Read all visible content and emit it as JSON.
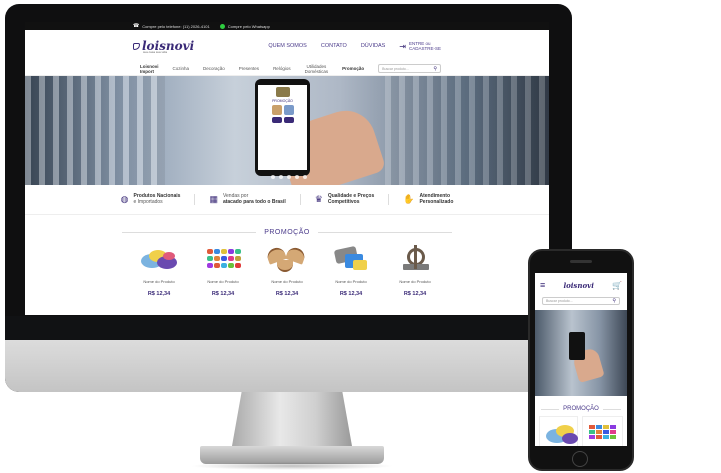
{
  "topbar": {
    "phone_text": "Compre pelo telefone: (11) 2026-4101",
    "whatsapp_text": "Compre pelo Whatsapp"
  },
  "header": {
    "logo_text": "loisnovi",
    "logo_sub": "sua casa sua vida",
    "nav": [
      "QUEM SOMOS",
      "CONTATO",
      "DÚVIDAS"
    ],
    "login_line1": "ENTRE ou",
    "login_line2": "CADASTRE-SE"
  },
  "categories": {
    "brand_line1": "Loisnovi",
    "brand_line2": "Import",
    "items": [
      "Cozinha",
      "Decoração",
      "Presentes",
      "Relógios"
    ],
    "utilities_line1": "Utilidades",
    "utilities_line2": "Domésticas",
    "promo": "Promoção",
    "search_placeholder": "Buscar produto..."
  },
  "hero": {
    "phone_promo": "PROMOÇÃO"
  },
  "features": [
    {
      "icon": "globe-icon",
      "line1": "Produtos Nacionais",
      "line2": "e Importados"
    },
    {
      "icon": "boxes-icon",
      "line1": "Vendas por",
      "line2": "atacado para todo o Brasil"
    },
    {
      "icon": "trophy-icon",
      "line1": "Qualidade e Preços",
      "line2": "Competitivos"
    },
    {
      "icon": "handshake-icon",
      "line1": "Atendimento",
      "line2": "Personalizado"
    }
  ],
  "promo": {
    "title": "PROMOÇÃO",
    "products": [
      {
        "name": "Nome do Produto",
        "price": "R$ 12,34"
      },
      {
        "name": "Nome do Produto",
        "price": "R$ 12,34"
      },
      {
        "name": "Nome do Produto",
        "price": "R$ 12,34"
      },
      {
        "name": "Nome do Produto",
        "price": "R$ 12,34"
      },
      {
        "name": "Nome do Produto",
        "price": "R$ 12,34"
      }
    ]
  },
  "mobile": {
    "logo_text": "loisnovi",
    "search_placeholder": "Buscar produto...",
    "promo_title": "PROMOÇÃO"
  },
  "colors": {
    "brand": "#3a2a77",
    "topbar": "#111111",
    "whatsapp": "#2ecc40"
  }
}
